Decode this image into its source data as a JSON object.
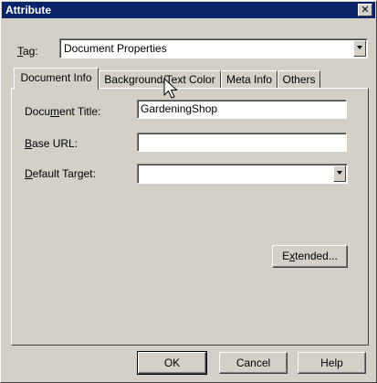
{
  "window": {
    "title": "Attribute",
    "close_glyph": "✕"
  },
  "tag": {
    "label_underlined": "T",
    "label_rest": "ag:",
    "value": "Document Properties"
  },
  "tabs": [
    {
      "label": "Document Info",
      "active": true
    },
    {
      "label": "Background/Text Color",
      "active": false
    },
    {
      "label": "Meta Info",
      "active": false
    },
    {
      "label": "Others",
      "active": false
    }
  ],
  "fields": {
    "title": {
      "pre": "Docu",
      "ul": "m",
      "post": "ent Title:",
      "value": "GardeningShop"
    },
    "base_url": {
      "ul": "B",
      "post": "ase URL:",
      "value": ""
    },
    "default_target": {
      "ul": "D",
      "post": "efault Target:",
      "value": ""
    }
  },
  "extended_button": {
    "pre": "E",
    "ul": "x",
    "post": "tended..."
  },
  "footer": {
    "ok": "OK",
    "cancel": "Cancel",
    "help": "Help"
  },
  "icons": {
    "cursor": "arrow-pointer-icon",
    "dropdown": "chevron-down-icon"
  }
}
